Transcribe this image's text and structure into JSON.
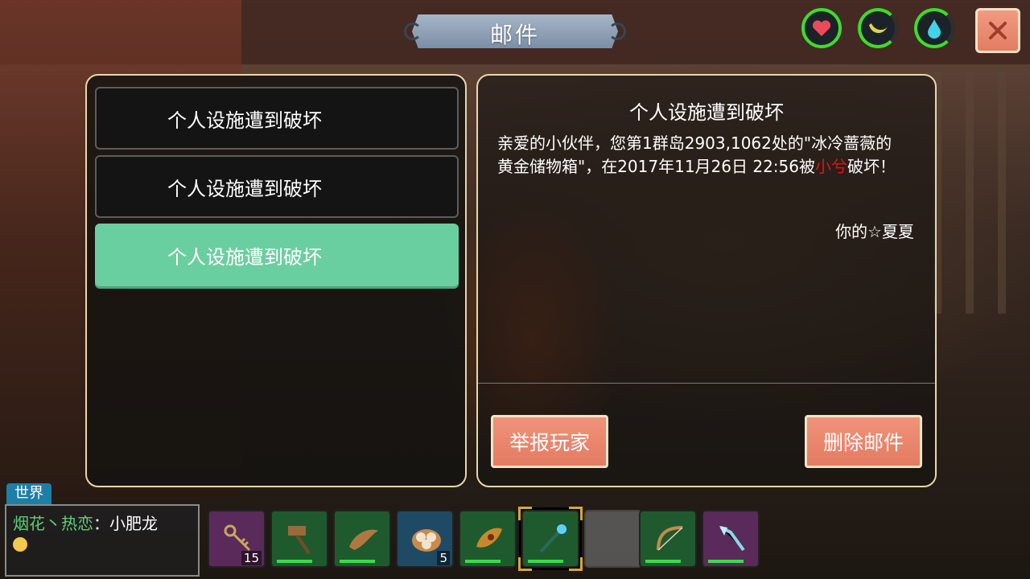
{
  "header": {
    "title": "邮件",
    "stats": [
      {
        "icon": "heart-icon",
        "color": "#e84b5a"
      },
      {
        "icon": "banana-icon",
        "color": "#e2d34a"
      },
      {
        "icon": "water-drop-icon",
        "color": "#3fd4e8"
      }
    ],
    "close_label": "✕"
  },
  "mail_list": {
    "items": [
      {
        "label": "个人设施遭到破坏",
        "selected": false
      },
      {
        "label": "个人设施遭到破坏",
        "selected": false
      },
      {
        "label": "个人设施遭到破坏",
        "selected": true
      }
    ]
  },
  "mail_detail": {
    "title": "个人设施遭到破坏",
    "body_before": "亲爱的小伙伴，您第1群岛2903,1062处的\"冰冷蔷薇的黄金储物箱\"，在2017年11月26日 22:56被",
    "body_highlight": "小兮",
    "body_after": "破坏！",
    "signature": "你的☆夏夏",
    "report_label": "举报玩家",
    "delete_label": "删除邮件"
  },
  "chat": {
    "tab_label": "世界",
    "sender": "烟花丶热恋",
    "separator": "：",
    "message": "小肥龙"
  },
  "hotbar": {
    "slots": [
      {
        "item": "keys-icon",
        "count": "15",
        "bg": "purple"
      },
      {
        "item": "hammer-icon",
        "count": "",
        "bg": "green"
      },
      {
        "item": "feather-icon",
        "count": "",
        "bg": "green"
      },
      {
        "item": "dumplings-icon",
        "count": "5",
        "bg": "blue"
      },
      {
        "item": "horn-icon",
        "count": "",
        "bg": "green"
      },
      {
        "item": "staff-icon",
        "count": "",
        "bg": "green"
      },
      {
        "item": "",
        "count": "",
        "bg": "empty"
      },
      {
        "item": "bow-icon",
        "count": "",
        "bg": "green"
      },
      {
        "item": "crystal-staff-icon",
        "count": "",
        "bg": "purple"
      }
    ]
  }
}
